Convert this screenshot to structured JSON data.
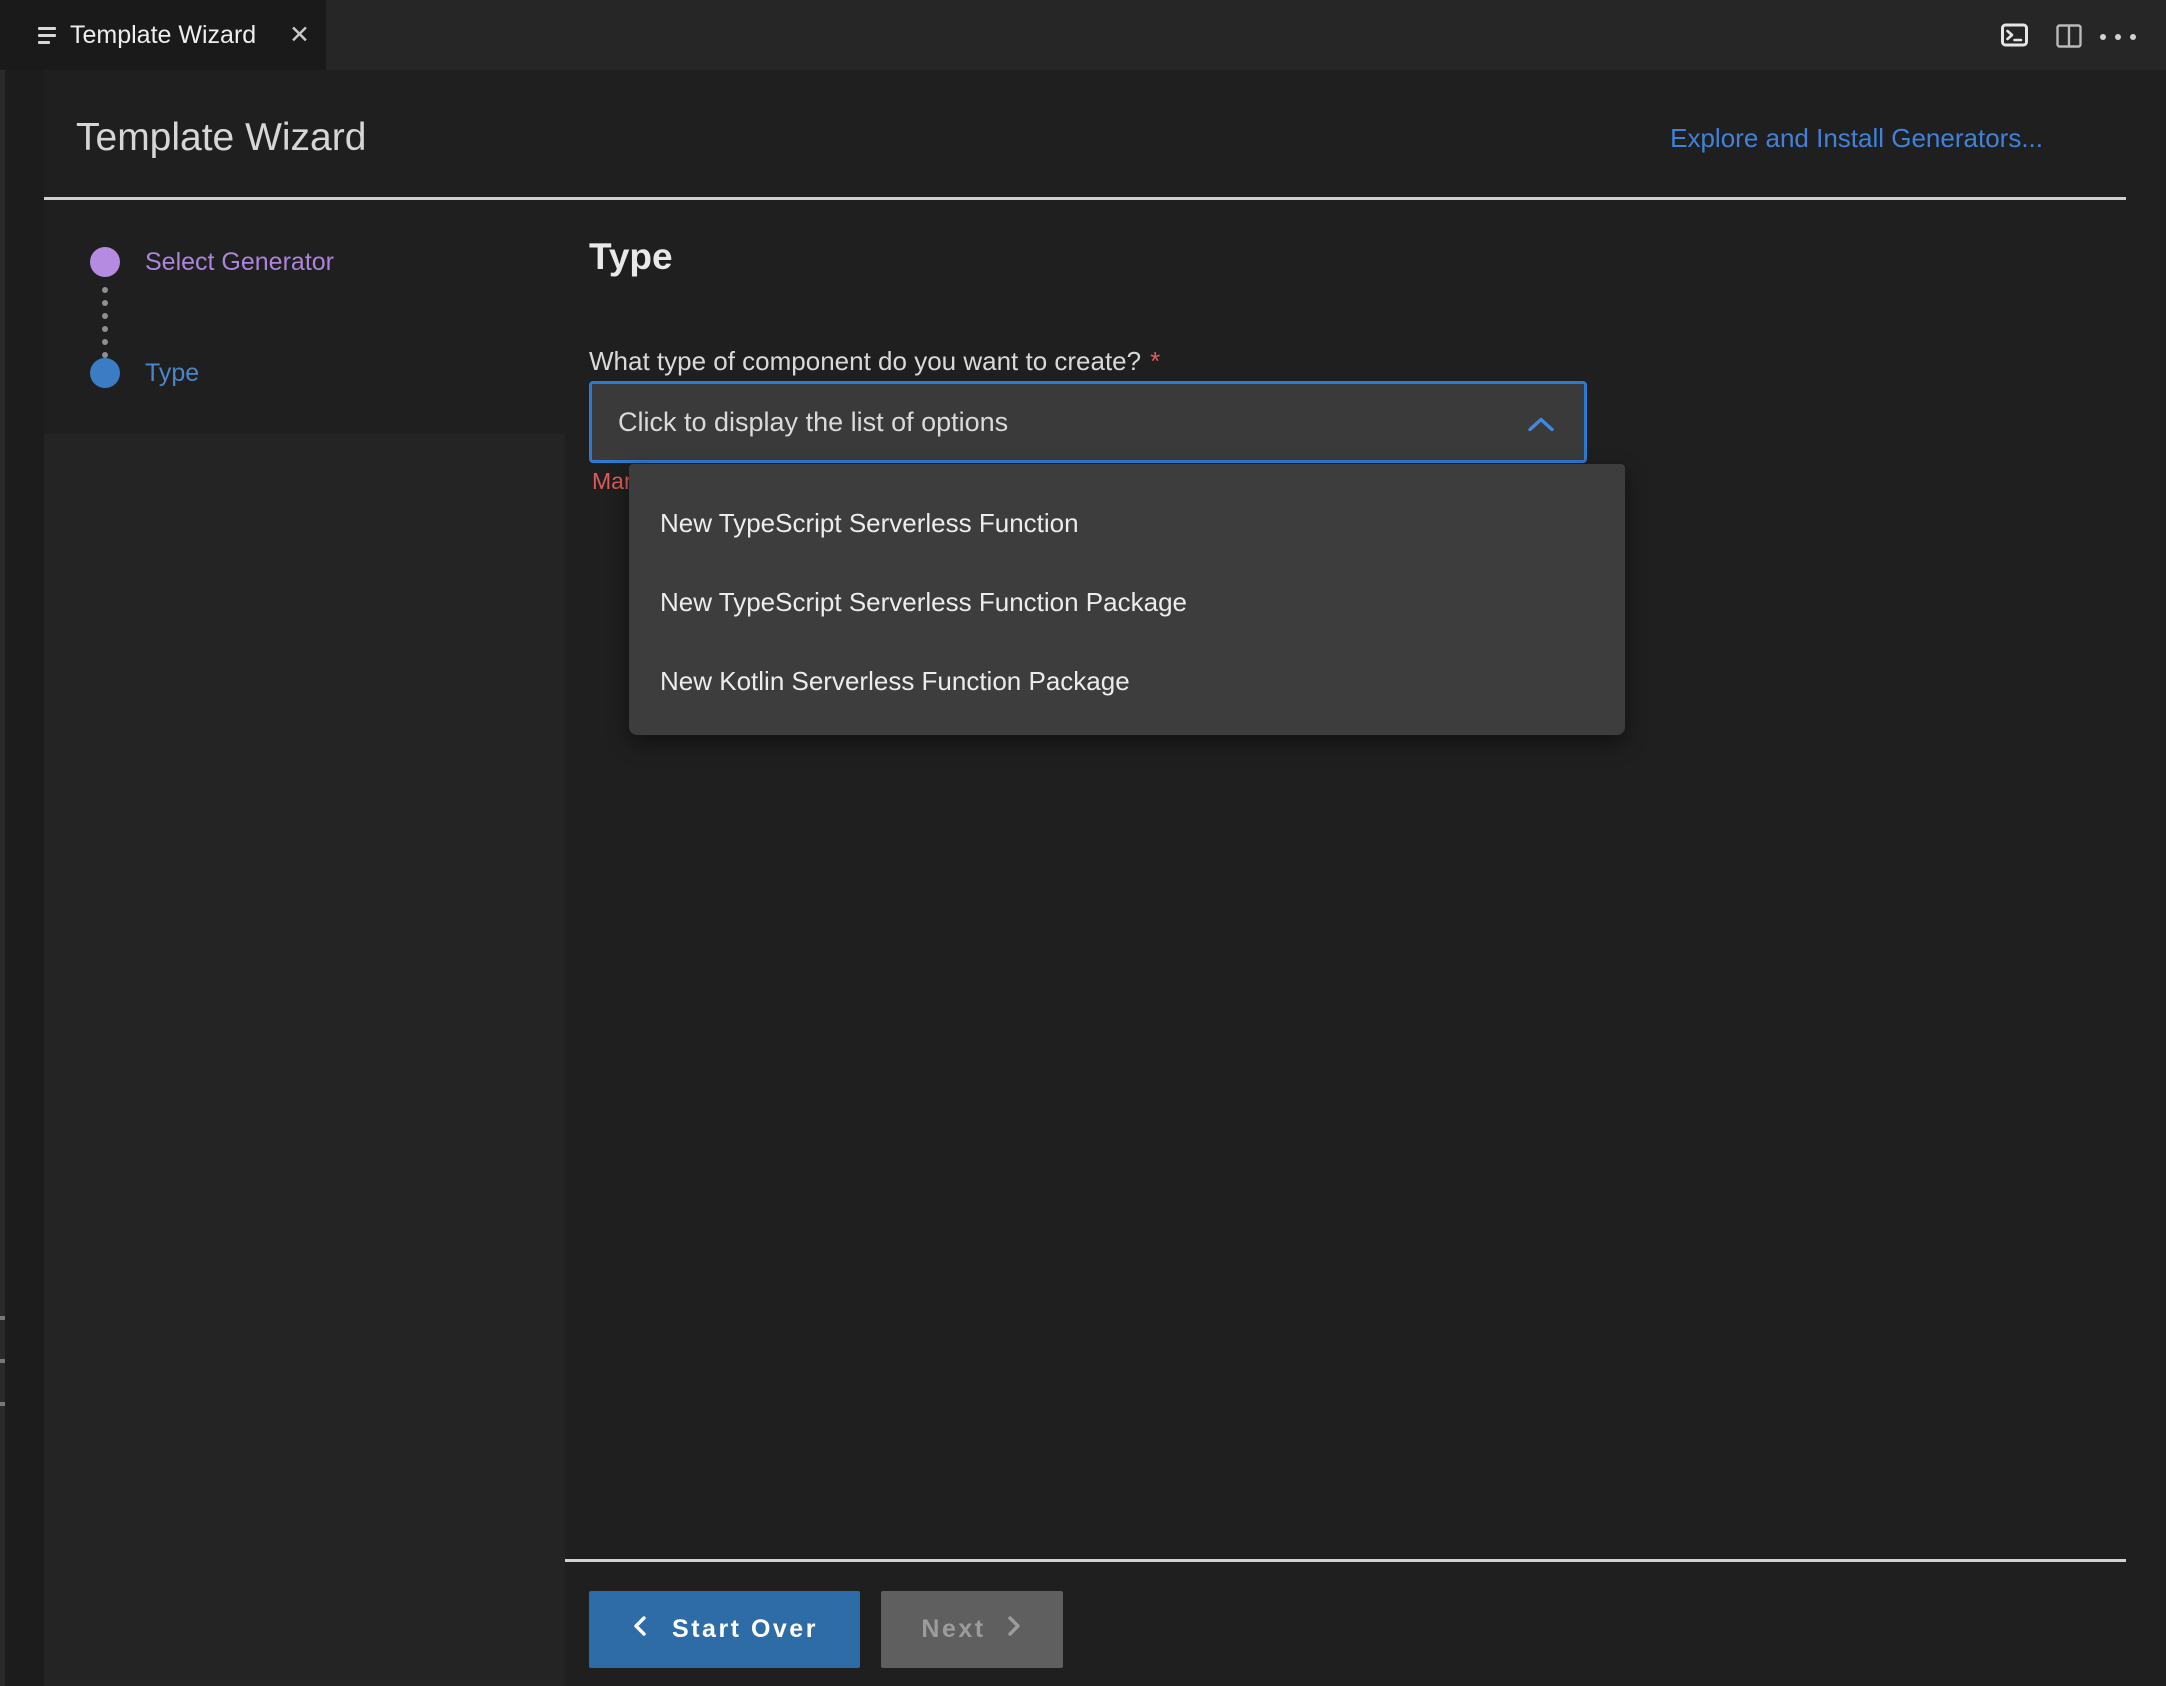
{
  "tab_bar": {
    "tab": {
      "title": "Template Wizard"
    },
    "close_label": "✕",
    "actions": {
      "terminal_icon": "open-terminal",
      "split_icon": "split-editor",
      "more_icon": "more-actions"
    }
  },
  "header": {
    "title": "Template Wizard",
    "link_label": "Explore and Install Generators..."
  },
  "stepper": {
    "steps": [
      {
        "label": "Select Generator"
      },
      {
        "label": "Type"
      }
    ]
  },
  "main": {
    "heading": "Type",
    "question": "What type of component do you want to create?",
    "required_marker": "*",
    "combobox_value": "Click to display the list of options",
    "helper_text": "Mandatory field",
    "options": [
      "New TypeScript Serverless Function",
      "New TypeScript Serverless Function Package",
      "New Kotlin Serverless Function Package"
    ]
  },
  "footer": {
    "start_over_label": "Start Over",
    "next_label": "Next"
  },
  "colors": {
    "accent_blue": "#2e7ad2",
    "link_blue": "#4181d9",
    "step_purple": "#b48be0",
    "step_blue": "#3b7cc4",
    "error_red": "#df5b5b",
    "primary_button_blue": "#2e6ca7",
    "disabled_button_gray": "#5f5f5f"
  }
}
